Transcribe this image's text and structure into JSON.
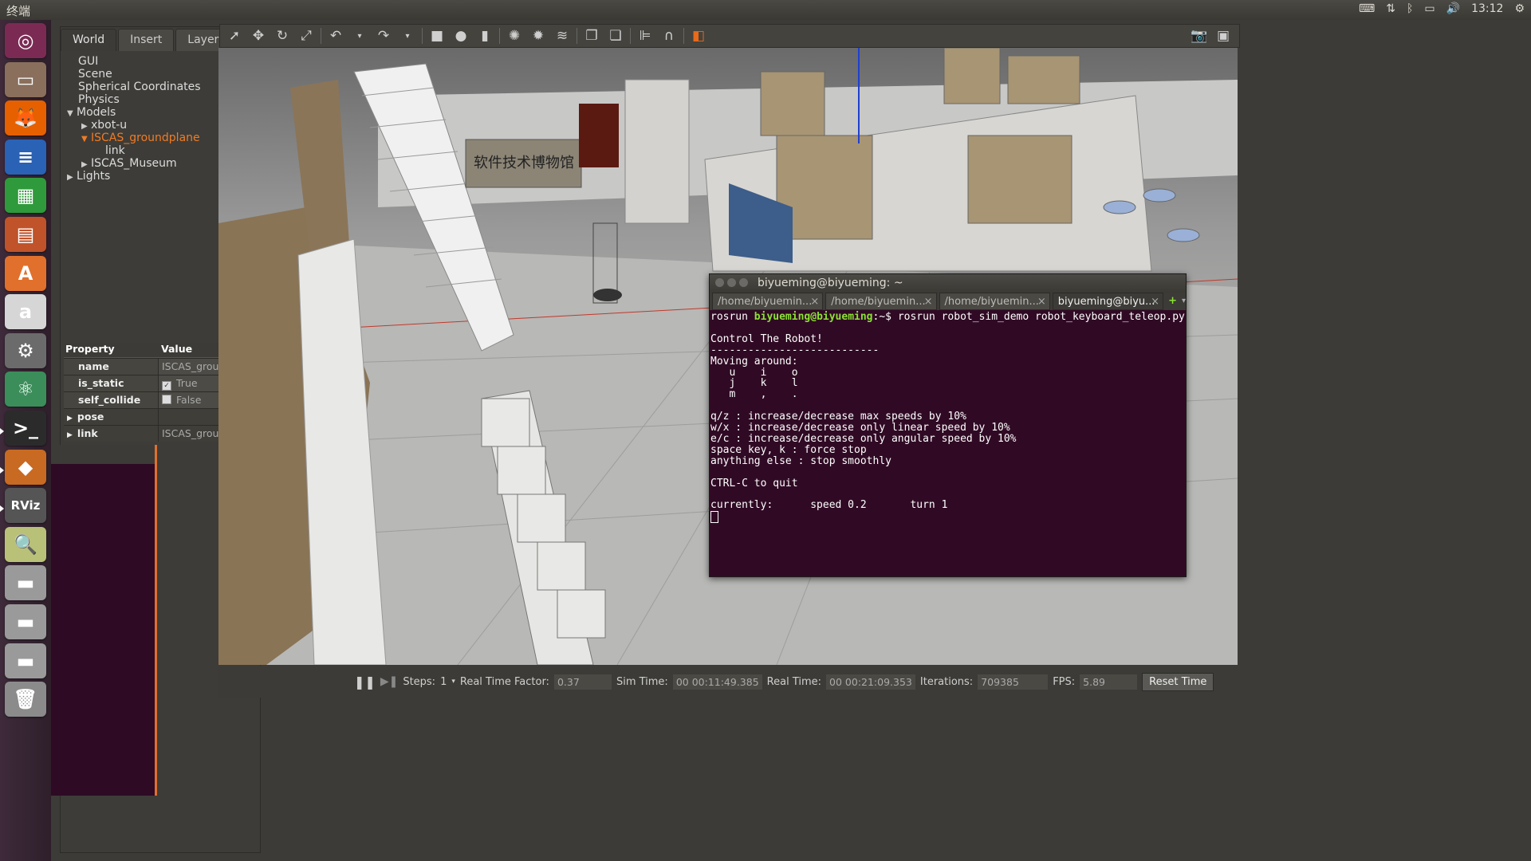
{
  "topbar": {
    "title": "终端",
    "time": "13:12"
  },
  "launcher": {
    "items": [
      {
        "name": "ubuntu-dash",
        "glyph": "◎",
        "color": "#7b2b53"
      },
      {
        "name": "files",
        "glyph": "▭",
        "color": "#8a6f5c"
      },
      {
        "name": "firefox",
        "glyph": "🦊",
        "color": "#e66000"
      },
      {
        "name": "writer",
        "glyph": "≡",
        "color": "#2a62b5"
      },
      {
        "name": "calc",
        "glyph": "▦",
        "color": "#2f9a3b"
      },
      {
        "name": "impress",
        "glyph": "▤",
        "color": "#c0532a"
      },
      {
        "name": "software-center",
        "glyph": "A",
        "color": "#e1702c"
      },
      {
        "name": "amazon",
        "glyph": "a",
        "color": "#d6d6d6"
      },
      {
        "name": "settings",
        "glyph": "⚙",
        "color": "#6b6b6b"
      },
      {
        "name": "atom",
        "glyph": "⚛",
        "color": "#3b8e5a"
      },
      {
        "name": "terminal",
        "glyph": ">_",
        "color": "#2b2b2b"
      },
      {
        "name": "gazebo",
        "glyph": "◆",
        "color": "#c86a22"
      },
      {
        "name": "rviz",
        "glyph": "RViz",
        "color": "#555"
      },
      {
        "name": "image-viewer",
        "glyph": "🔍",
        "color": "#b9c178"
      },
      {
        "name": "disk-1",
        "glyph": "▬",
        "color": "#9a9a9a"
      },
      {
        "name": "disk-2",
        "glyph": "▬",
        "color": "#9a9a9a"
      },
      {
        "name": "disk-3",
        "glyph": "▬",
        "color": "#9a9a9a"
      },
      {
        "name": "trash",
        "glyph": "🗑",
        "color": "#8b8b8b"
      }
    ]
  },
  "gazebo": {
    "tabs": [
      "World",
      "Insert",
      "Layers"
    ],
    "tree": {
      "gui": "GUI",
      "scene": "Scene",
      "spherical": "Spherical Coordinates",
      "physics": "Physics",
      "models": "Models",
      "xbot": "xbot-u",
      "ground": "ISCAS_groundplane",
      "link": "link",
      "museum": "ISCAS_Museum",
      "lights": "Lights"
    },
    "props": {
      "header_property": "Property",
      "header_value": "Value",
      "name_k": "name",
      "name_v": "ISCAS_groundpl...",
      "static_k": "is_static",
      "static_v": "True",
      "collide_k": "self_collide",
      "collide_v": "False",
      "pose_k": "pose",
      "link_k": "link",
      "link_v": "ISCAS_groundpl..."
    },
    "bottom": {
      "steps_label": "Steps:",
      "steps_value": "1",
      "rtf_label": "Real Time Factor:",
      "rtf_value": "0.37",
      "sim_label": "Sim Time:",
      "sim_value": "00 00:11:49.385",
      "real_label": "Real Time:",
      "real_value": "00 00:21:09.353",
      "iter_label": "Iterations:",
      "iter_value": "709385",
      "fps_label": "FPS:",
      "fps_value": "5.89",
      "reset": "Reset Time"
    },
    "scene_sign": "软件技术博物馆"
  },
  "terminal": {
    "title": "biyueming@biyueming: ~",
    "tabs": [
      "/home/biyuemin...",
      "/home/biyuemin...",
      "/home/biyuemin...",
      "biyueming@biyu..."
    ],
    "cmd_pre": "rosrun ",
    "prompt": "biyueming@biyueming",
    "cmd_post": ":~$ rosrun robot_sim_demo robot_keyboard_teleop.py",
    "lines": [
      "",
      "Control The Robot!",
      "---------------------------",
      "Moving around:",
      "   u    i    o",
      "   j    k    l",
      "   m    ,    .",
      "",
      "q/z : increase/decrease max speeds by 10%",
      "w/x : increase/decrease only linear speed by 10%",
      "e/c : increase/decrease only angular speed by 10%",
      "space key, k : force stop",
      "anything else : stop smoothly",
      "",
      "CTRL-C to quit",
      "",
      "currently:      speed 0.2       turn 1"
    ]
  }
}
